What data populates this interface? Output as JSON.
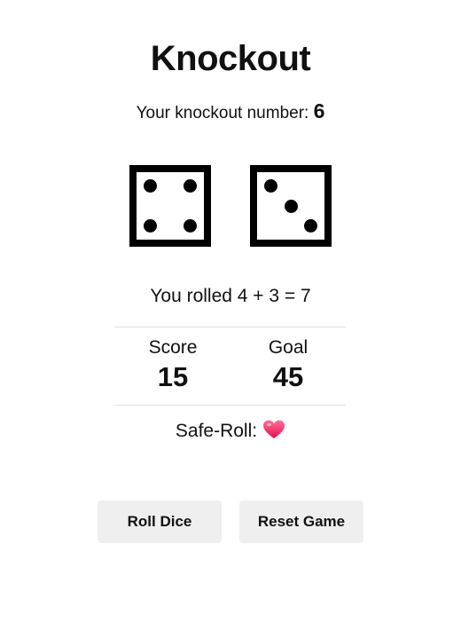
{
  "game": {
    "title": "Knockout",
    "knockout_label": "Your knockout number:",
    "knockout_number": "6",
    "dice": [
      4,
      3
    ],
    "rolled_text": "You rolled 4 + 3 = 7",
    "score_label": "Score",
    "score_value": "15",
    "goal_label": "Goal",
    "goal_value": "45",
    "safe_roll_label": "Safe-Roll:",
    "safe_roll_icon": "heart-icon"
  },
  "buttons": {
    "roll_label": "Roll Dice",
    "reset_label": "Reset Game"
  },
  "colors": {
    "die": "#000000",
    "button_bg": "#efefef",
    "divider": "#e0e0e0",
    "heart_top": "#ff5f8f",
    "heart_bottom": "#e8124f"
  }
}
